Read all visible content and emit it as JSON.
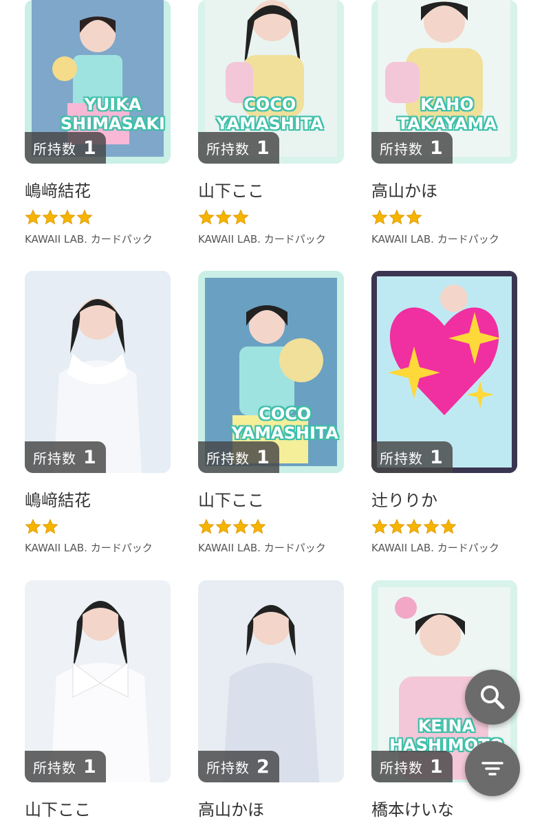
{
  "cards": [
    {
      "name": "嶋﨑結花",
      "stars": 4,
      "pack": "KAWAII LAB. カードパック",
      "owned_label": "所持数",
      "owned": "1",
      "overlay": [
        "YUIKA",
        "SHIMASAKI"
      ]
    },
    {
      "name": "山下ここ",
      "stars": 3,
      "pack": "KAWAII LAB. カードパック",
      "owned_label": "所持数",
      "owned": "1",
      "overlay": [
        "COCO",
        "YAMASHITA"
      ]
    },
    {
      "name": "高山かほ",
      "stars": 3,
      "pack": "KAWAII LAB. カードパック",
      "owned_label": "所持数",
      "owned": "1",
      "overlay": [
        "KAHO",
        "TAKAYAMA"
      ]
    },
    {
      "name": "嶋﨑結花",
      "stars": 2,
      "pack": "KAWAII LAB. カードパック",
      "owned_label": "所持数",
      "owned": "1",
      "overlay": []
    },
    {
      "name": "山下ここ",
      "stars": 4,
      "pack": "KAWAII LAB. カードパック",
      "owned_label": "所持数",
      "owned": "1",
      "overlay": [
        "COCO",
        "YAMASHITA"
      ]
    },
    {
      "name": "辻りりか",
      "stars": 5,
      "pack": "KAWAII LAB. カードパック",
      "owned_label": "所持数",
      "owned": "1",
      "overlay": []
    },
    {
      "name": "山下ここ",
      "stars": 0,
      "pack": "",
      "owned_label": "所持数",
      "owned": "1",
      "overlay": []
    },
    {
      "name": "高山かほ",
      "stars": 0,
      "pack": "",
      "owned_label": "所持数",
      "owned": "2",
      "overlay": []
    },
    {
      "name": "橋本けいな",
      "stars": 0,
      "pack": "",
      "owned_label": "所持数",
      "owned": "1",
      "overlay": [
        "KEINA",
        "HASHIMOTO"
      ]
    }
  ],
  "fab": {
    "search_icon": "search-icon",
    "filter_icon": "filter-icon"
  },
  "colors": {
    "star": "#f5b400",
    "fab": "#6b6b6b",
    "mint": "#bfeee3",
    "badge": "#464646"
  }
}
